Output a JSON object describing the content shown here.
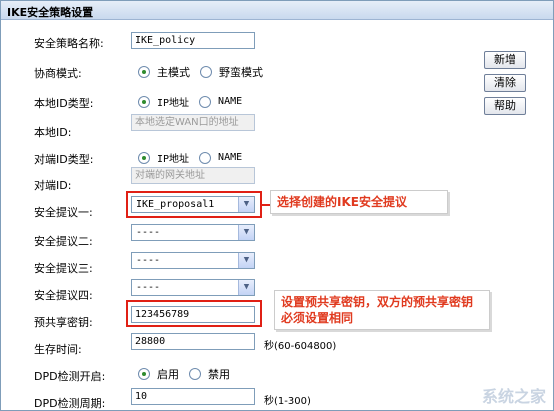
{
  "page": {
    "title": "IKE安全策略设置"
  },
  "fields": {
    "policy_name": {
      "label": "安全策略名称:",
      "value": "IKE_policy"
    },
    "negotiation_mode": {
      "label": "协商模式:",
      "options": [
        "主模式",
        "野蛮模式"
      ],
      "selected": "主模式"
    },
    "local_id_type": {
      "label": "本地ID类型:",
      "options": [
        "IP地址",
        "NAME"
      ],
      "selected": "IP地址"
    },
    "local_id": {
      "label": "本地ID:",
      "placeholder": "本地选定WAN口的地址"
    },
    "remote_id_type": {
      "label": "对端ID类型:",
      "options": [
        "IP地址",
        "NAME"
      ],
      "selected": "IP地址"
    },
    "remote_id": {
      "label": "对端ID:",
      "placeholder": "对端的网关地址"
    },
    "proposal1": {
      "label": "安全提议一:",
      "value": "IKE_proposal1"
    },
    "proposal2": {
      "label": "安全提议二:",
      "value": "----"
    },
    "proposal3": {
      "label": "安全提议三:",
      "value": "----"
    },
    "proposal4": {
      "label": "安全提议四:",
      "value": "----"
    },
    "psk": {
      "label": "预共享密钥:",
      "value": "123456789"
    },
    "lifetime": {
      "label": "生存时间:",
      "value": "28800",
      "unit": "秒(60-604800)"
    },
    "dpd_enable": {
      "label": "DPD检测开启:",
      "options": [
        "启用",
        "禁用"
      ],
      "selected": "启用"
    },
    "dpd_interval": {
      "label": "DPD检测周期:",
      "value": "10",
      "unit": "秒(1-300)"
    }
  },
  "buttons": {
    "add": "新增",
    "clear": "清除",
    "help": "帮助"
  },
  "callouts": {
    "proposal": "选择创建的IKE安全提议",
    "psk": "设置预共享密钥，双方的预共享密钥必须设置相同"
  },
  "watermark": "系统之家",
  "colors": {
    "callout_text": "#e03a1f",
    "highlight_border": "#e02015",
    "title_bar": "#c9d9ee"
  }
}
